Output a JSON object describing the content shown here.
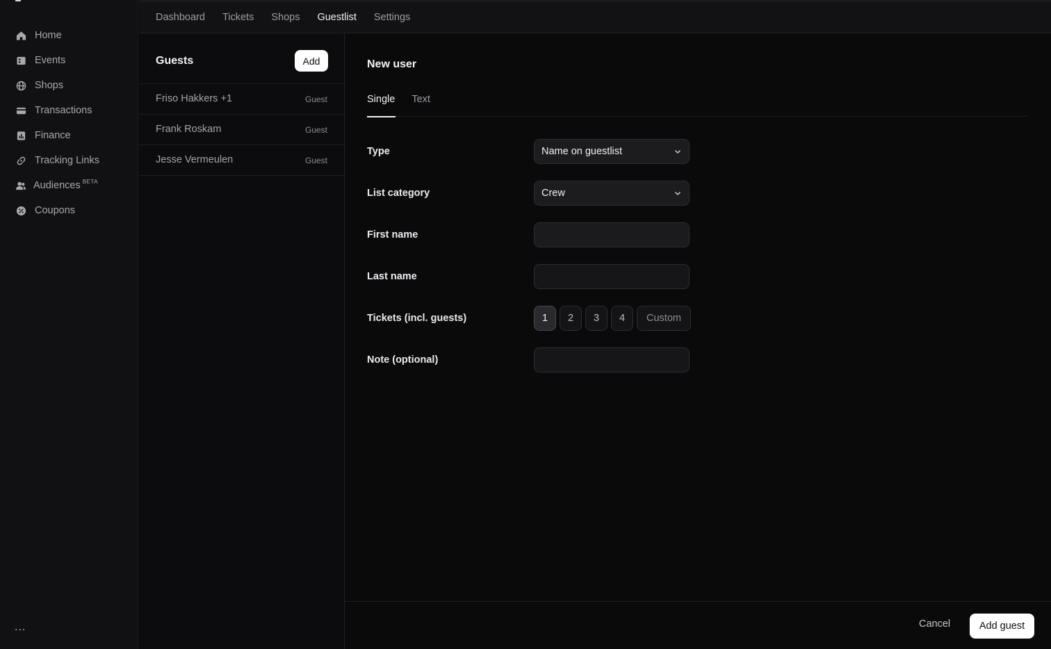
{
  "sidebar": {
    "items": [
      {
        "label": "Home",
        "icon": "home-icon"
      },
      {
        "label": "Events",
        "icon": "events-icon"
      },
      {
        "label": "Shops",
        "icon": "globe-icon"
      },
      {
        "label": "Transactions",
        "icon": "credit-card-icon"
      },
      {
        "label": "Finance",
        "icon": "finance-icon"
      },
      {
        "label": "Tracking Links",
        "icon": "link-icon"
      },
      {
        "label": "Audiences",
        "icon": "users-icon",
        "badge": "BETA"
      },
      {
        "label": "Coupons",
        "icon": "coupon-icon"
      }
    ],
    "more": "..."
  },
  "topnav": {
    "tabs": [
      "Dashboard",
      "Tickets",
      "Shops",
      "Guestlist",
      "Settings"
    ],
    "active": "Guestlist"
  },
  "guests": {
    "title": "Guests",
    "add_label": "Add",
    "rows": [
      {
        "name": "Friso Hakkers +1",
        "badge": "Guest"
      },
      {
        "name": "Frank Roskam",
        "badge": "Guest"
      },
      {
        "name": "Jesse Vermeulen",
        "badge": "Guest"
      }
    ]
  },
  "form": {
    "title": "New user",
    "tabs": [
      "Single",
      "Text"
    ],
    "active_tab": "Single",
    "type": {
      "label": "Type",
      "value": "Name on guestlist"
    },
    "list_category": {
      "label": "List category",
      "value": "Crew"
    },
    "first_name": {
      "label": "First name",
      "value": ""
    },
    "last_name": {
      "label": "Last name",
      "value": ""
    },
    "tickets": {
      "label": "Tickets (incl. guests)",
      "options": [
        "1",
        "2",
        "3",
        "4"
      ],
      "custom": "Custom",
      "selected": "1"
    },
    "note": {
      "label": "Note (optional)",
      "value": ""
    }
  },
  "footer": {
    "cancel_label": "Cancel",
    "submit_label": "Add guest"
  }
}
